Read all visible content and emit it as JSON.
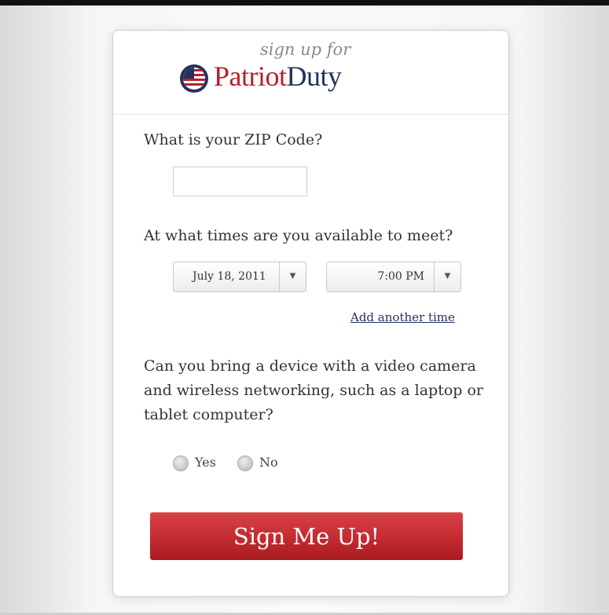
{
  "header": {
    "subtitle": "sign up for",
    "brand_part1": "Patriot",
    "brand_part2": "Duty",
    "brand_red": "#b5202a",
    "brand_navy": "#25315e"
  },
  "zip": {
    "label": "What is your ZIP Code?",
    "value": "",
    "placeholder": ""
  },
  "availability": {
    "label": "At what times are you available to meet?",
    "date_value": "July 18, 2011",
    "time_value": "7:00 PM",
    "add_link": "Add another time"
  },
  "device": {
    "label": "Can you bring a device with a video camera and wireless networking, such as a laptop or tablet computer?",
    "yes_label": "Yes",
    "no_label": "No"
  },
  "submit": {
    "label": "Sign Me Up!",
    "color": "#c52d33"
  },
  "icons": {
    "logo": "flag-circle-icon",
    "dropdown": "caret-down-icon"
  }
}
